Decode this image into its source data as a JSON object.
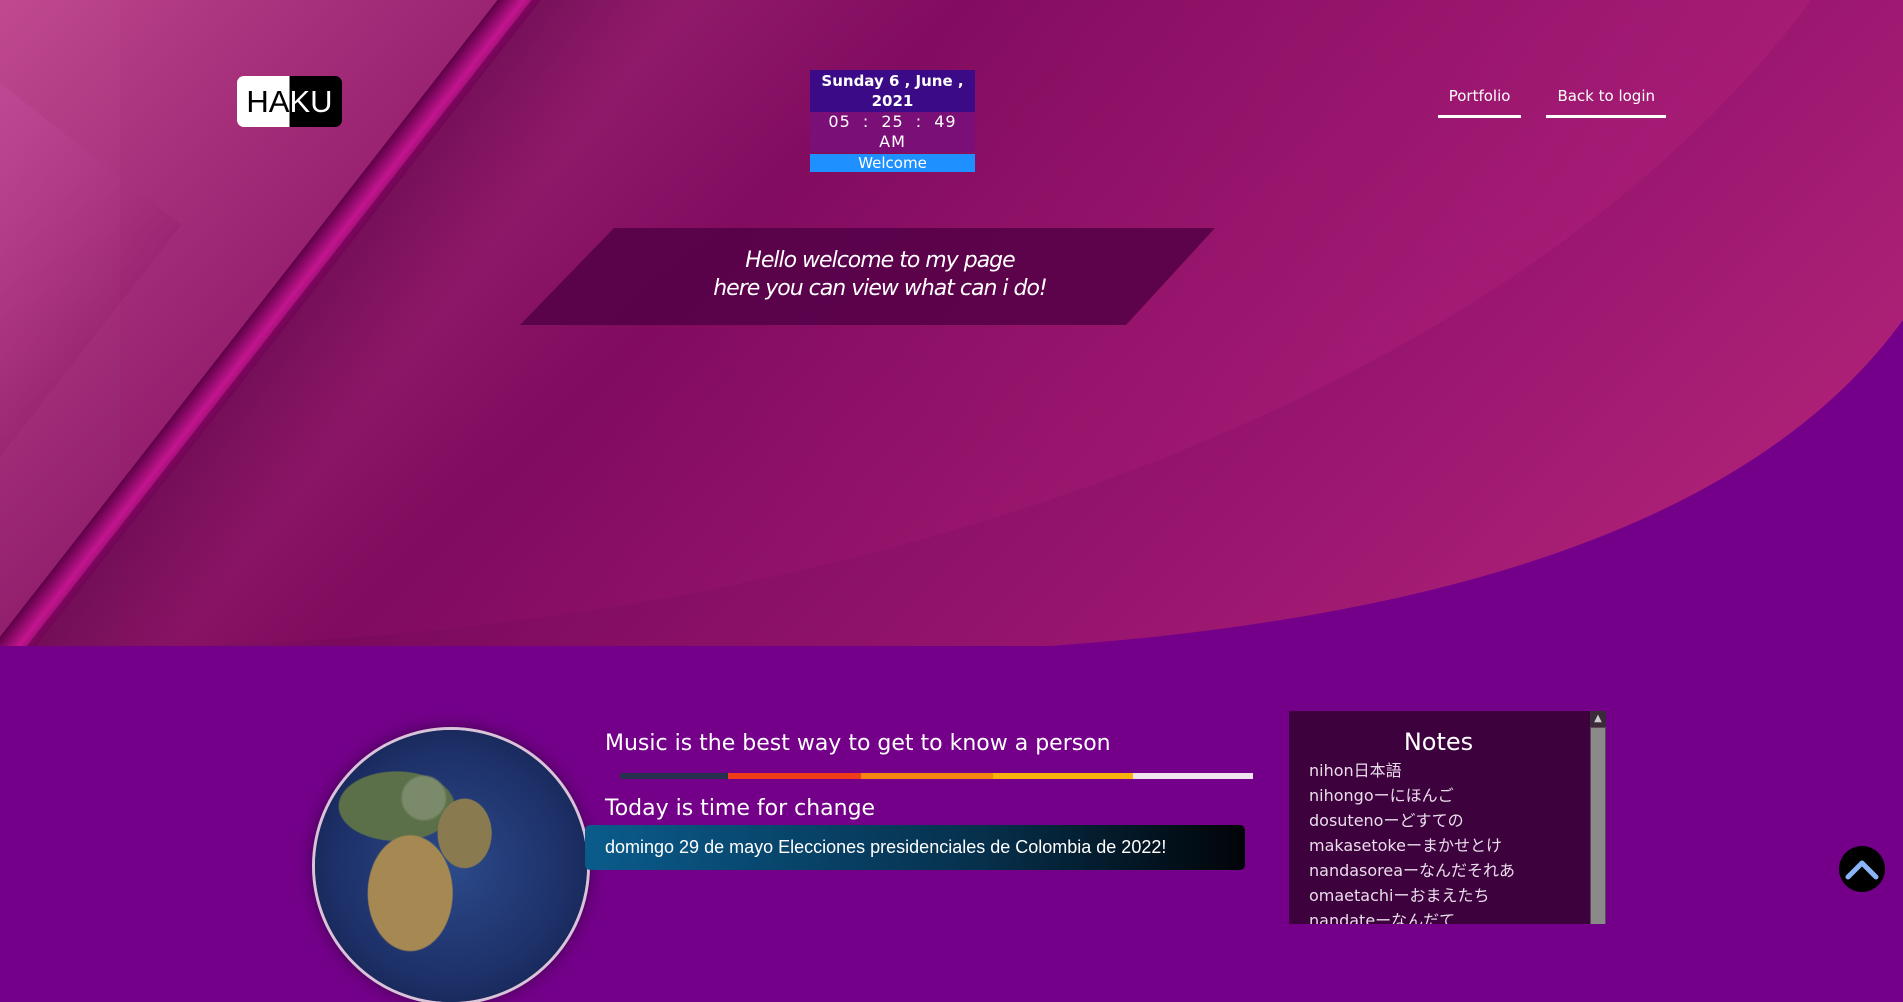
{
  "header": {
    "logo": "HAKU",
    "clock": {
      "date": "Sunday 6 , June , 2021",
      "time": "05 : 25 : 49 AM",
      "greeting": "Welcome"
    },
    "nav": [
      {
        "label": "Portfolio"
      },
      {
        "label": "Back to login"
      }
    ]
  },
  "hero": {
    "line1": "Hello welcome to my page",
    "line2": "here you can view what can i do!"
  },
  "content": {
    "music_heading": "Music is the best way to get to know a person",
    "color_bar": [
      "#27304c",
      "#ef3d1a",
      "#f4860f",
      "#f8b20b",
      "#f1e4f1"
    ],
    "change_heading": "Today is time for change",
    "news": "domingo 29 de mayo Elecciones presidenciales de Colombia de 2022!"
  },
  "notes": {
    "title": "Notes",
    "items": [
      "nihon日本語",
      "nihongoーにほんご",
      "dosutenoーどすての",
      "makasetokeーまかせとけ",
      "nandasoreaーなんだそれあ",
      "omaetachiーおまえたち",
      "nandateーなんだて"
    ]
  },
  "icons": {
    "scroll_top": "chevron-up-icon",
    "scroll_top_color": "#8ab4f8"
  }
}
